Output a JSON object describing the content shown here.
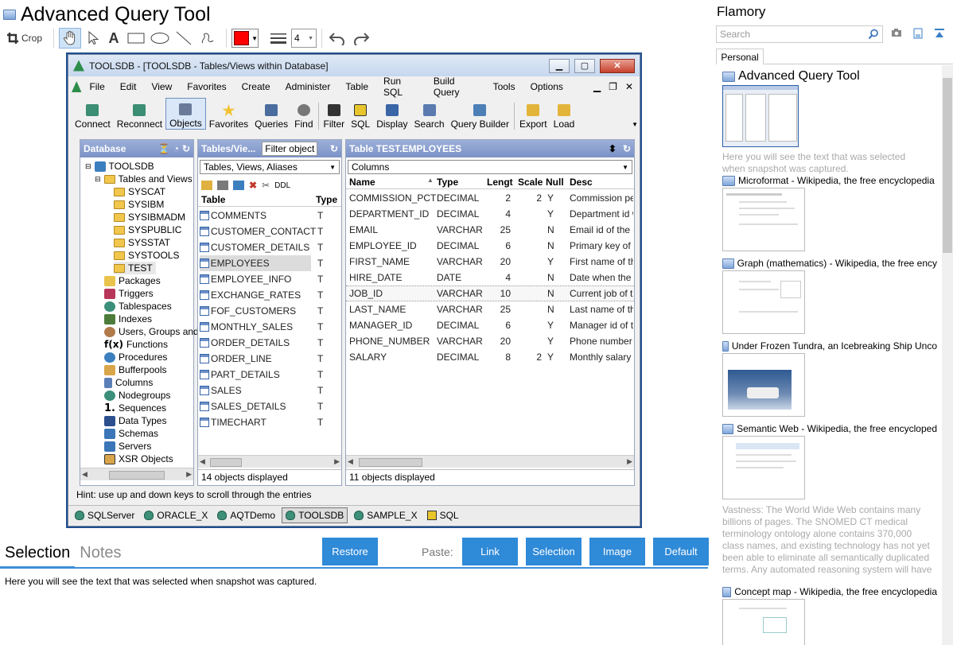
{
  "app": {
    "title": "Advanced Query Tool"
  },
  "toolbar": {
    "crop_label": "Crop",
    "line_width": "4"
  },
  "snapshot": {
    "window_title": "TOOLSDB - [TOOLSDB - Tables/Views within Database]",
    "menu": [
      "File",
      "Edit",
      "View",
      "Favorites",
      "Create",
      "Administer",
      "Table",
      "Run SQL",
      "Build Query",
      "Tools",
      "Options"
    ],
    "tools": [
      "Connect",
      "Reconnect",
      "Objects",
      "Favorites",
      "Queries",
      "Find",
      "Filter",
      "SQL",
      "Display",
      "Search",
      "Query Builder",
      "Export",
      "Load"
    ],
    "db_panel": {
      "title": "Database",
      "tree": [
        "TOOLSDB",
        "Tables and Views",
        "SYSCAT",
        "SYSIBM",
        "SYSIBMADM",
        "SYSPUBLIC",
        "SYSSTAT",
        "SYSTOOLS",
        "TEST",
        "Packages",
        "Triggers",
        "Tablespaces",
        "Indexes",
        "Users, Groups and",
        "Functions",
        "Procedures",
        "Bufferpools",
        "Columns",
        "Nodegroups",
        "Sequences",
        "Data Types",
        "Schemas",
        "Servers",
        "XSR Objects"
      ]
    },
    "tables_panel": {
      "title": "Tables/Vie...",
      "filter_button": "Filter object",
      "combo": "Tables, Views, Aliases",
      "ddl": "DDL",
      "col_table": "Table",
      "col_type": "Type",
      "rows": [
        {
          "name": "COMMENTS",
          "type": "T"
        },
        {
          "name": "CUSTOMER_CONTACT",
          "type": "T"
        },
        {
          "name": "CUSTOMER_DETAILS",
          "type": "T"
        },
        {
          "name": "EMPLOYEES",
          "type": "T"
        },
        {
          "name": "EMPLOYEE_INFO",
          "type": "T"
        },
        {
          "name": "EXCHANGE_RATES",
          "type": "T"
        },
        {
          "name": "FOF_CUSTOMERS",
          "type": "T"
        },
        {
          "name": "MONTHLY_SALES",
          "type": "T"
        },
        {
          "name": "ORDER_DETAILS",
          "type": "T"
        },
        {
          "name": "ORDER_LINE",
          "type": "T"
        },
        {
          "name": "PART_DETAILS",
          "type": "T"
        },
        {
          "name": "SALES",
          "type": "T"
        },
        {
          "name": "SALES_DETAILS",
          "type": "T"
        },
        {
          "name": "TIMECHART",
          "type": "T"
        }
      ],
      "status": "14 objects displayed"
    },
    "columns_panel": {
      "title": "Table TEST.EMPLOYEES",
      "combo": "Columns",
      "headers": [
        "Name",
        "Type",
        "Lengt",
        "Scale",
        "Null",
        "Desc"
      ],
      "rows": [
        {
          "name": "COMMISSION_PCT",
          "type": "DECIMAL",
          "len": "2",
          "scale": "2",
          "null": "Y",
          "desc": "Commission per"
        },
        {
          "name": "DEPARTMENT_ID",
          "type": "DECIMAL",
          "len": "4",
          "scale": "",
          "null": "Y",
          "desc": "Department id w"
        },
        {
          "name": "EMAIL",
          "type": "VARCHAR",
          "len": "25",
          "scale": "",
          "null": "N",
          "desc": "Email id of the er"
        },
        {
          "name": "EMPLOYEE_ID",
          "type": "DECIMAL",
          "len": "6",
          "scale": "",
          "null": "N",
          "desc": "Primary key of e"
        },
        {
          "name": "FIRST_NAME",
          "type": "VARCHAR",
          "len": "20",
          "scale": "",
          "null": "Y",
          "desc": "First name of the"
        },
        {
          "name": "HIRE_DATE",
          "type": "DATE",
          "len": "4",
          "scale": "",
          "null": "N",
          "desc": "Date when the er"
        },
        {
          "name": "JOB_ID",
          "type": "VARCHAR",
          "len": "10",
          "scale": "",
          "null": "N",
          "desc": "Current job of th"
        },
        {
          "name": "LAST_NAME",
          "type": "VARCHAR",
          "len": "25",
          "scale": "",
          "null": "N",
          "desc": "Last name of the"
        },
        {
          "name": "MANAGER_ID",
          "type": "DECIMAL",
          "len": "6",
          "scale": "",
          "null": "Y",
          "desc": "Manager id of th"
        },
        {
          "name": "PHONE_NUMBER",
          "type": "VARCHAR",
          "len": "20",
          "scale": "",
          "null": "Y",
          "desc": "Phone number o"
        },
        {
          "name": "SALARY",
          "type": "DECIMAL",
          "len": "8",
          "scale": "2",
          "null": "Y",
          "desc": "Monthly salary c"
        }
      ],
      "status": "11 objects displayed"
    },
    "hint": "Hint: use up and down keys to scroll through the entries",
    "connections": [
      "SQLServer",
      "ORACLE_X",
      "AQTDemo",
      "TOOLSDB",
      "SAMPLE_X",
      "SQL"
    ]
  },
  "bottom": {
    "tab_selection": "Selection",
    "tab_notes": "Notes",
    "restore": "Restore",
    "paste_label": "Paste:",
    "paste_link": "Link",
    "paste_selection": "Selection",
    "paste_image": "Image",
    "paste_default": "Default",
    "selection_text": "Here you will see the text that was selected when snapshot was captured."
  },
  "right": {
    "title": "Flamory",
    "search_placeholder": "Search",
    "tab_personal": "Personal",
    "items": [
      {
        "title": "Advanced Query Tool",
        "desc": "Here you will see the text that was selected when snapshot was captured."
      },
      {
        "title": "Microformat - Wikipedia, the free encyclopedia"
      },
      {
        "title": "Graph (mathematics) - Wikipedia, the free ency"
      },
      {
        "title": "Under Frozen Tundra, an Icebreaking Ship Unco"
      },
      {
        "title": "Semantic Web - Wikipedia, the free encycloped",
        "desc": "Vastness: The World Wide Web contains many billions of pages. The SNOMED CT medical terminology ontology alone contains 370,000 class names, and existing technology has not yet been able to eliminate all semantically duplicated terms. Any automated reasoning system will have to deal with truly huge inputs."
      },
      {
        "title": "Concept map - Wikipedia, the free encyclopedia"
      }
    ]
  },
  "colors": {
    "accent": "#2f8ad8",
    "selected_color": "#ff0000",
    "panel_header": "#8ea3d1"
  }
}
